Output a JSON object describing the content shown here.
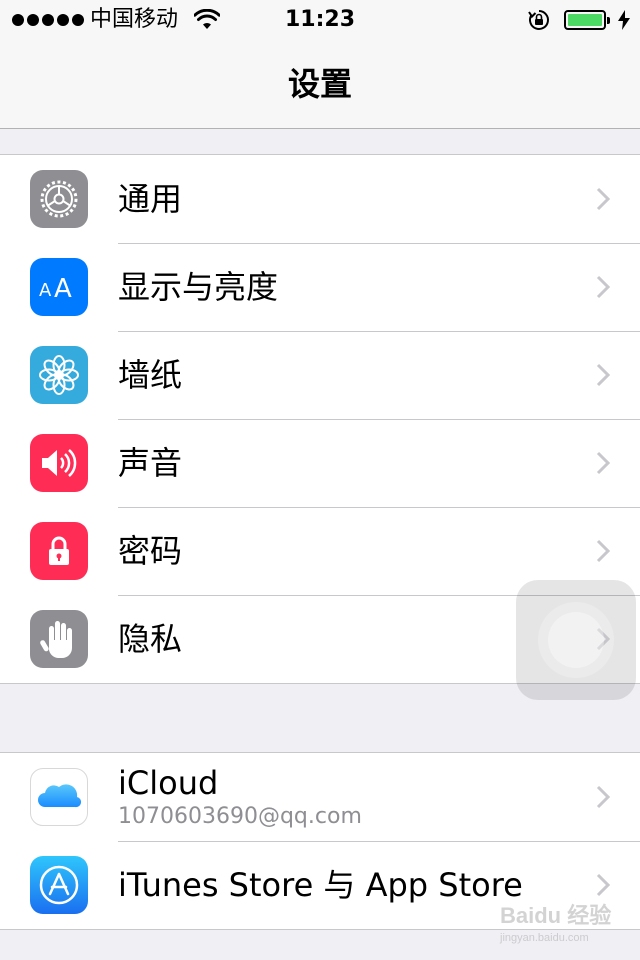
{
  "status_bar": {
    "carrier": "中国移动",
    "time": "11:23",
    "battery_level": 1.0
  },
  "nav": {
    "title": "设置"
  },
  "group1": [
    {
      "label": "通用",
      "icon": "gear-icon",
      "color": "#8e8e93"
    },
    {
      "label": "显示与亮度",
      "icon": "display-brightness-icon",
      "color": "#007aff"
    },
    {
      "label": "墙纸",
      "icon": "wallpaper-flower-icon",
      "color": "#35aadc"
    },
    {
      "label": "声音",
      "icon": "speaker-icon",
      "color": "#ff2d55"
    },
    {
      "label": "密码",
      "icon": "lock-icon",
      "color": "#ff2d55"
    },
    {
      "label": "隐私",
      "icon": "hand-icon",
      "color": "#8e8e93"
    }
  ],
  "group2": [
    {
      "label": "iCloud",
      "sublabel": "1070603690@qq.com",
      "icon": "icloud-icon",
      "color": "#ffffff"
    },
    {
      "label": "iTunes Store 与 App Store",
      "icon": "app-store-icon",
      "color": "#1a8cff"
    }
  ],
  "display_icon_text": "AA",
  "watermark": {
    "main": "Baidu 经验",
    "sub": "jingyan.baidu.com"
  }
}
